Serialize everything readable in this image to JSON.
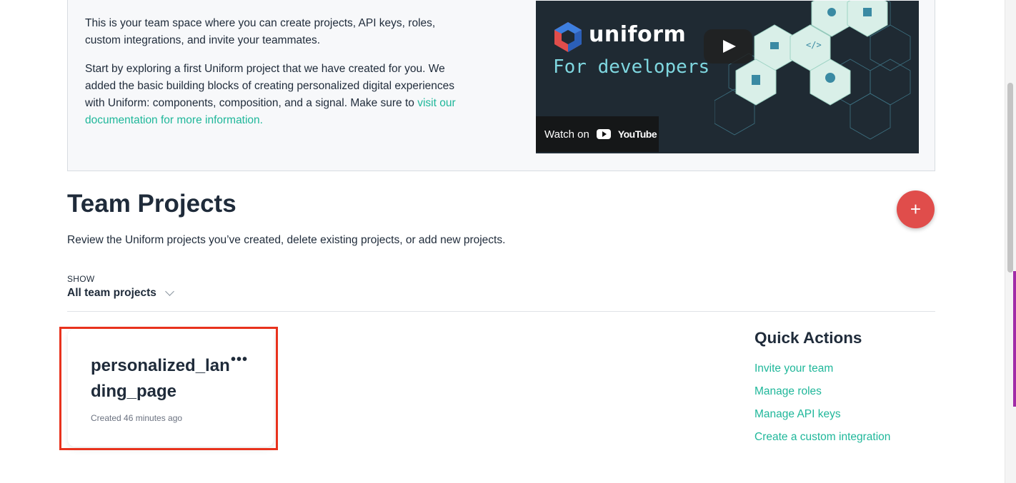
{
  "intro": {
    "paragraph1": "This is your team space where you can create projects, API keys, roles, custom integrations, and invite your teammates.",
    "paragraph2_text": "Start by exploring a first Uniform project that we have created for you. We added the basic building blocks of creating personalized digital experiences with Uniform: components, composition, and a signal. Make sure to ",
    "paragraph2_link": "visit our documentation for more information."
  },
  "video": {
    "brand": "uniform",
    "tagline": "For developers",
    "watch_on": "Watch on",
    "youtube": "YouTube",
    "brand_color": "#e04d4b"
  },
  "projects": {
    "title": "Team Projects",
    "description": "Review the Uniform projects you’ve created, delete existing projects, or add new projects.",
    "add_button_label": "+",
    "filter": {
      "label": "SHOW",
      "selected": "All team projects"
    },
    "items": [
      {
        "name": "personalized_landing_page",
        "menu": "•••",
        "created": "Created 46 minutes ago"
      }
    ]
  },
  "quick_actions": {
    "title": "Quick Actions",
    "links": [
      "Invite your team",
      "Manage roles",
      "Manage API keys",
      "Create a custom integration"
    ]
  },
  "colors": {
    "accent": "#1fb79a",
    "add_button": "#e04d4b",
    "highlight": "#e8321d",
    "text": "#1f2b3a"
  }
}
